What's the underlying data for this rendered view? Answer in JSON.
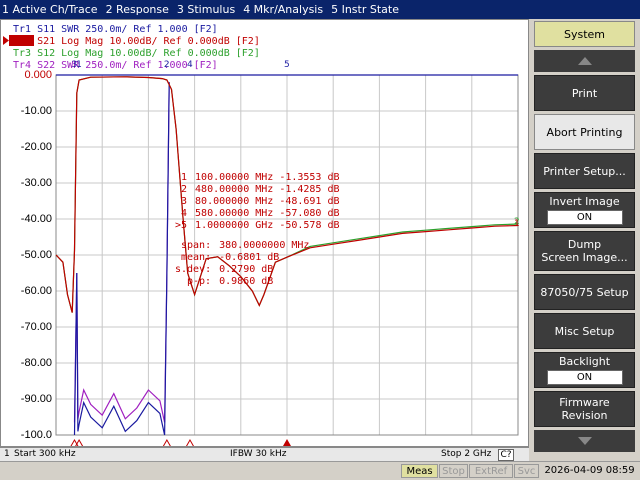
{
  "menu": [
    "1 Active Ch/Trace",
    "2 Response",
    "3 Stimulus",
    "4 Mkr/Analysis",
    "5 Instr State"
  ],
  "traces": [
    {
      "label": "Tr1  S11  SWR  250.0m/  Ref 1.000  [F2]",
      "color": "#1a1aa0"
    },
    {
      "label": "Tr2  S21  Log Mag 10.00dB/ Ref 0.000dB [F2]",
      "color": "#c00000"
    },
    {
      "label": "Tr3  S12  Log Mag 10.00dB/ Ref 0.000dB [F2]",
      "color": "#2ca02c"
    },
    {
      "label": "Tr4  S22  SWR  250.0m/  Ref 1.000  [F2]",
      "color": "#a020c0"
    }
  ],
  "yticks": [
    "0.000",
    "-10.00",
    "-20.00",
    "-30.00",
    "-40.00",
    "-50.00",
    "-60.00",
    "-70.00",
    "-80.00",
    "-90.00",
    "-100.0"
  ],
  "markers": [
    {
      "n": "1",
      "freq": "100.00000 MHz",
      "val": "-1.3553 dB"
    },
    {
      "n": "2",
      "freq": "480.00000 MHz",
      "val": "-1.4285 dB"
    },
    {
      "n": "3",
      "freq": "80.000000 MHz",
      "val": "-48.691 dB"
    },
    {
      "n": "4",
      "freq": "580.00000 MHz",
      "val": "-57.080 dB"
    },
    {
      "n": ">5",
      "freq": "1.0000000 GHz",
      "val": "-50.578 dB"
    }
  ],
  "stats": [
    {
      "k": "span:",
      "v": "380.0000000 MHz"
    },
    {
      "k": "mean:",
      "v": "-0.6801 dB"
    },
    {
      "k": "s.dev:",
      "v": "0.2790 dB"
    },
    {
      "k": "p-p:",
      "v": "0.9860 dB"
    }
  ],
  "status": {
    "channel": "1",
    "start": "Start 300 kHz",
    "ifbw": "IFBW 30 kHz",
    "stop": "Stop 2 GHz",
    "cal": "C?"
  },
  "bottom": {
    "meas": "Meas",
    "stop": "Stop",
    "extref": "ExtRef",
    "svc": "Svc",
    "datetime": "2026-04-09 08:59"
  },
  "softkeys": {
    "title": "System",
    "print": "Print",
    "abort": "Abort Printing",
    "printer_setup": "Printer Setup...",
    "invert_image": "Invert Image",
    "invert_state": "ON",
    "dump1": "Dump",
    "dump2": "Screen Image...",
    "setup_87050": "87050/75 Setup",
    "misc": "Misc Setup",
    "backlight": "Backlight",
    "backlight_state": "ON",
    "firmware1": "Firmware",
    "firmware2": "Revision"
  },
  "right_end_values": [
    "1",
    "2"
  ],
  "trace_points_s21": [
    [
      0.0003,
      -50
    ],
    [
      0.03,
      -52
    ],
    [
      0.05,
      -61
    ],
    [
      0.07,
      -66
    ],
    [
      0.08,
      -48.7
    ],
    [
      0.09,
      -5
    ],
    [
      0.1,
      -1.4
    ],
    [
      0.15,
      -0.6
    ],
    [
      0.3,
      -0.5
    ],
    [
      0.4,
      -0.7
    ],
    [
      0.46,
      -1
    ],
    [
      0.48,
      -1.4
    ],
    [
      0.5,
      -4
    ],
    [
      0.52,
      -15
    ],
    [
      0.55,
      -40
    ],
    [
      0.57,
      -55
    ],
    [
      0.58,
      -57.1
    ],
    [
      0.6,
      -61
    ],
    [
      0.65,
      -51
    ],
    [
      0.7,
      -50.5
    ],
    [
      0.75,
      -53
    ],
    [
      0.8,
      -56
    ],
    [
      0.85,
      -60
    ],
    [
      0.88,
      -64
    ],
    [
      0.9,
      -61
    ],
    [
      0.95,
      -52
    ],
    [
      1.0,
      -50.6
    ],
    [
      1.1,
      -48
    ],
    [
      1.2,
      -47
    ],
    [
      1.3,
      -46
    ],
    [
      1.4,
      -45
    ],
    [
      1.5,
      -44
    ],
    [
      1.6,
      -43.5
    ],
    [
      1.7,
      -43
    ],
    [
      1.8,
      -42.5
    ],
    [
      1.9,
      -42
    ],
    [
      2.0,
      -41.8
    ]
  ]
}
